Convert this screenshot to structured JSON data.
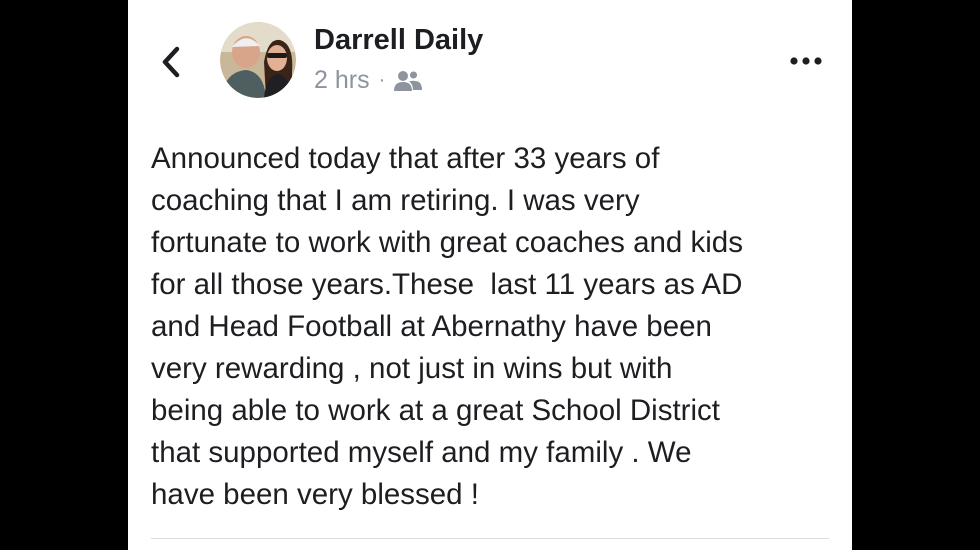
{
  "post": {
    "author": "Darrell Daily",
    "timestamp": "2 hrs",
    "separator": "·",
    "audience_icon": "friends-icon",
    "back_icon": "chevron-left-icon",
    "menu_icon": "more-dots-icon",
    "lines": [
      "Announced today that after 33 years of",
      "coaching that I am retiring. I was very",
      "fortunate to work with great coaches and kids",
      "for all those years.These  last 11 years as AD",
      "and Head Football at Abernathy have been",
      "very rewarding , not just in wins but with",
      "being able to work at a great School District",
      "that supported myself and my family . We",
      "have been very blessed !"
    ]
  },
  "colors": {
    "background": "#000000",
    "panel": "#ffffff",
    "text": "#1c1e21",
    "meta": "#8d949e"
  }
}
